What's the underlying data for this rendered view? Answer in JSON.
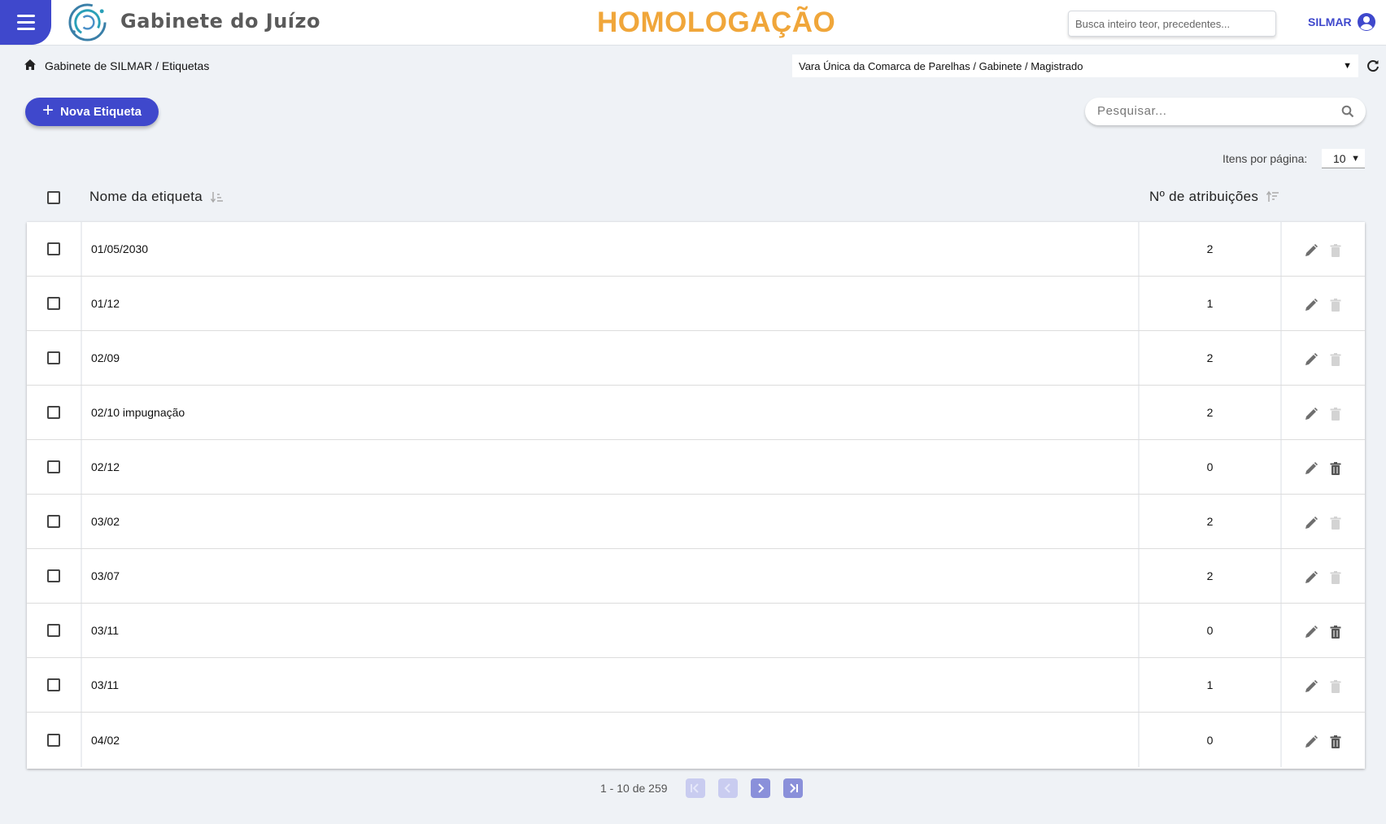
{
  "header": {
    "app_title": "Gabinete do Juízo",
    "environment": "HOMOLOGAÇÃO",
    "global_search_placeholder": "Busca inteiro teor, precedentes...",
    "user_name": "SILMAR"
  },
  "breadcrumb": {
    "path": "Gabinete de SILMAR / Etiquetas"
  },
  "unit_selector": {
    "selected": "Vara Única da Comarca de Parelhas / Gabinete / Magistrado"
  },
  "actions": {
    "new_label": "Nova Etiqueta",
    "search_placeholder": "Pesquisar..."
  },
  "paging": {
    "per_page_label": "Itens por página:",
    "per_page": "10",
    "range": "1 - 10 de 259"
  },
  "columns": {
    "name": "Nome da etiqueta",
    "count": "Nº de atribuições"
  },
  "rows": [
    {
      "name": "01/05/2030",
      "count": "2",
      "deletable": false
    },
    {
      "name": "01/12",
      "count": "1",
      "deletable": false
    },
    {
      "name": "02/09",
      "count": "2",
      "deletable": false
    },
    {
      "name": "02/10 impugnação",
      "count": "2",
      "deletable": false
    },
    {
      "name": "02/12",
      "count": "0",
      "deletable": true
    },
    {
      "name": "03/02",
      "count": "2",
      "deletable": false
    },
    {
      "name": "03/07",
      "count": "2",
      "deletable": false
    },
    {
      "name": "03/11",
      "count": "0",
      "deletable": true
    },
    {
      "name": "03/11",
      "count": "1",
      "deletable": false
    },
    {
      "name": "04/02",
      "count": "0",
      "deletable": true
    }
  ],
  "colors": {
    "primary": "#3f48cc",
    "environment": "#f0a63a",
    "background": "#eff2f6"
  },
  "icons": {
    "menu": "hamburger-icon",
    "home": "home-icon",
    "refresh": "refresh-icon",
    "search": "search-icon",
    "user": "account-circle-icon",
    "edit": "pencil-icon",
    "delete": "trash-icon"
  }
}
